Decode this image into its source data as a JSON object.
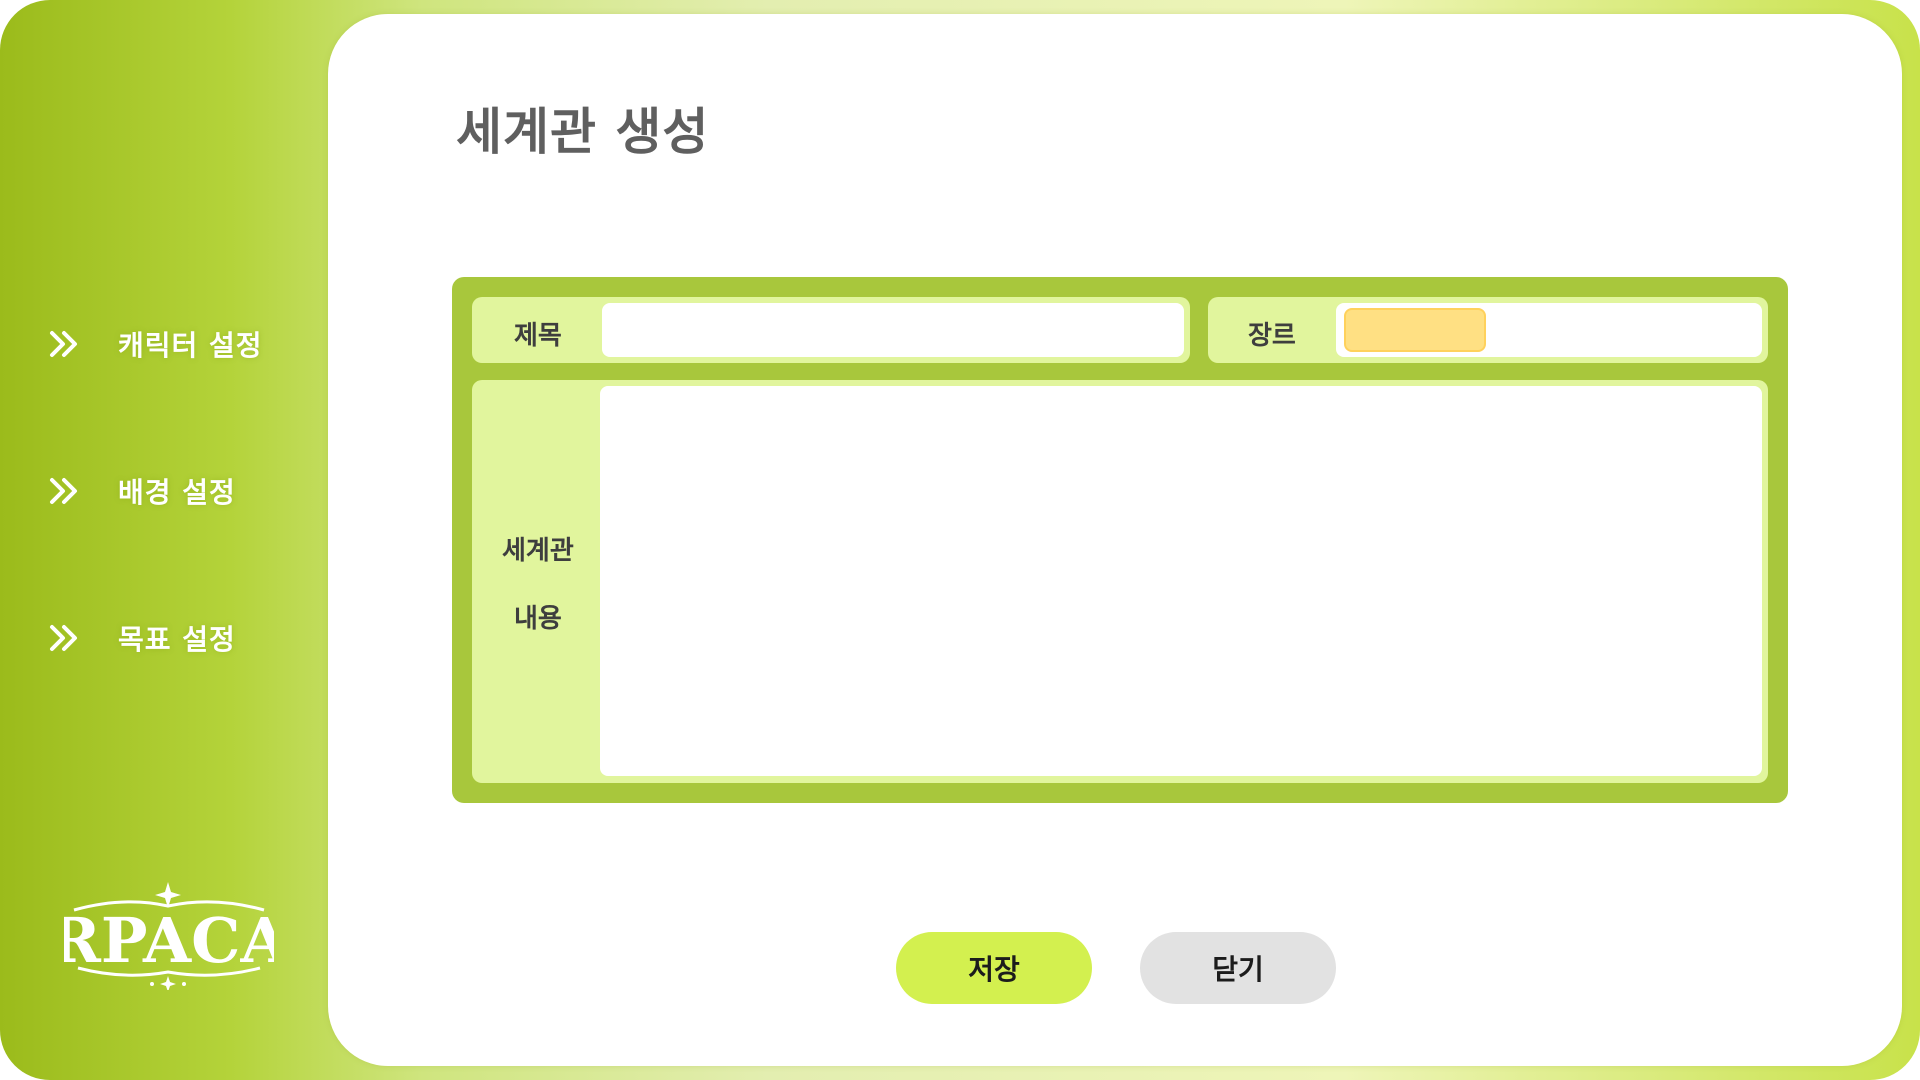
{
  "sidebar": {
    "items": [
      {
        "label": "캐릭터 설정",
        "icon": "double-chevron-right-icon"
      },
      {
        "label": "배경 설정",
        "icon": "double-chevron-right-icon"
      },
      {
        "label": "목표 설정",
        "icon": "double-chevron-right-icon"
      }
    ],
    "logo_text": "RPACA"
  },
  "main": {
    "title": "세계관 생성",
    "form": {
      "title_label": "제목",
      "title_value": "",
      "genre_label": "장르",
      "genre_value": "",
      "content_label_line1": "세계관",
      "content_label_line2": "내용",
      "content_value": ""
    },
    "buttons": {
      "save_label": "저장",
      "close_label": "닫기"
    }
  },
  "colors": {
    "accent": "#a8c73c",
    "field_bg": "#e1f59d",
    "save_button": "#d3f04f",
    "close_button": "#e2e2e2",
    "genre_chip": "#ffe083"
  }
}
